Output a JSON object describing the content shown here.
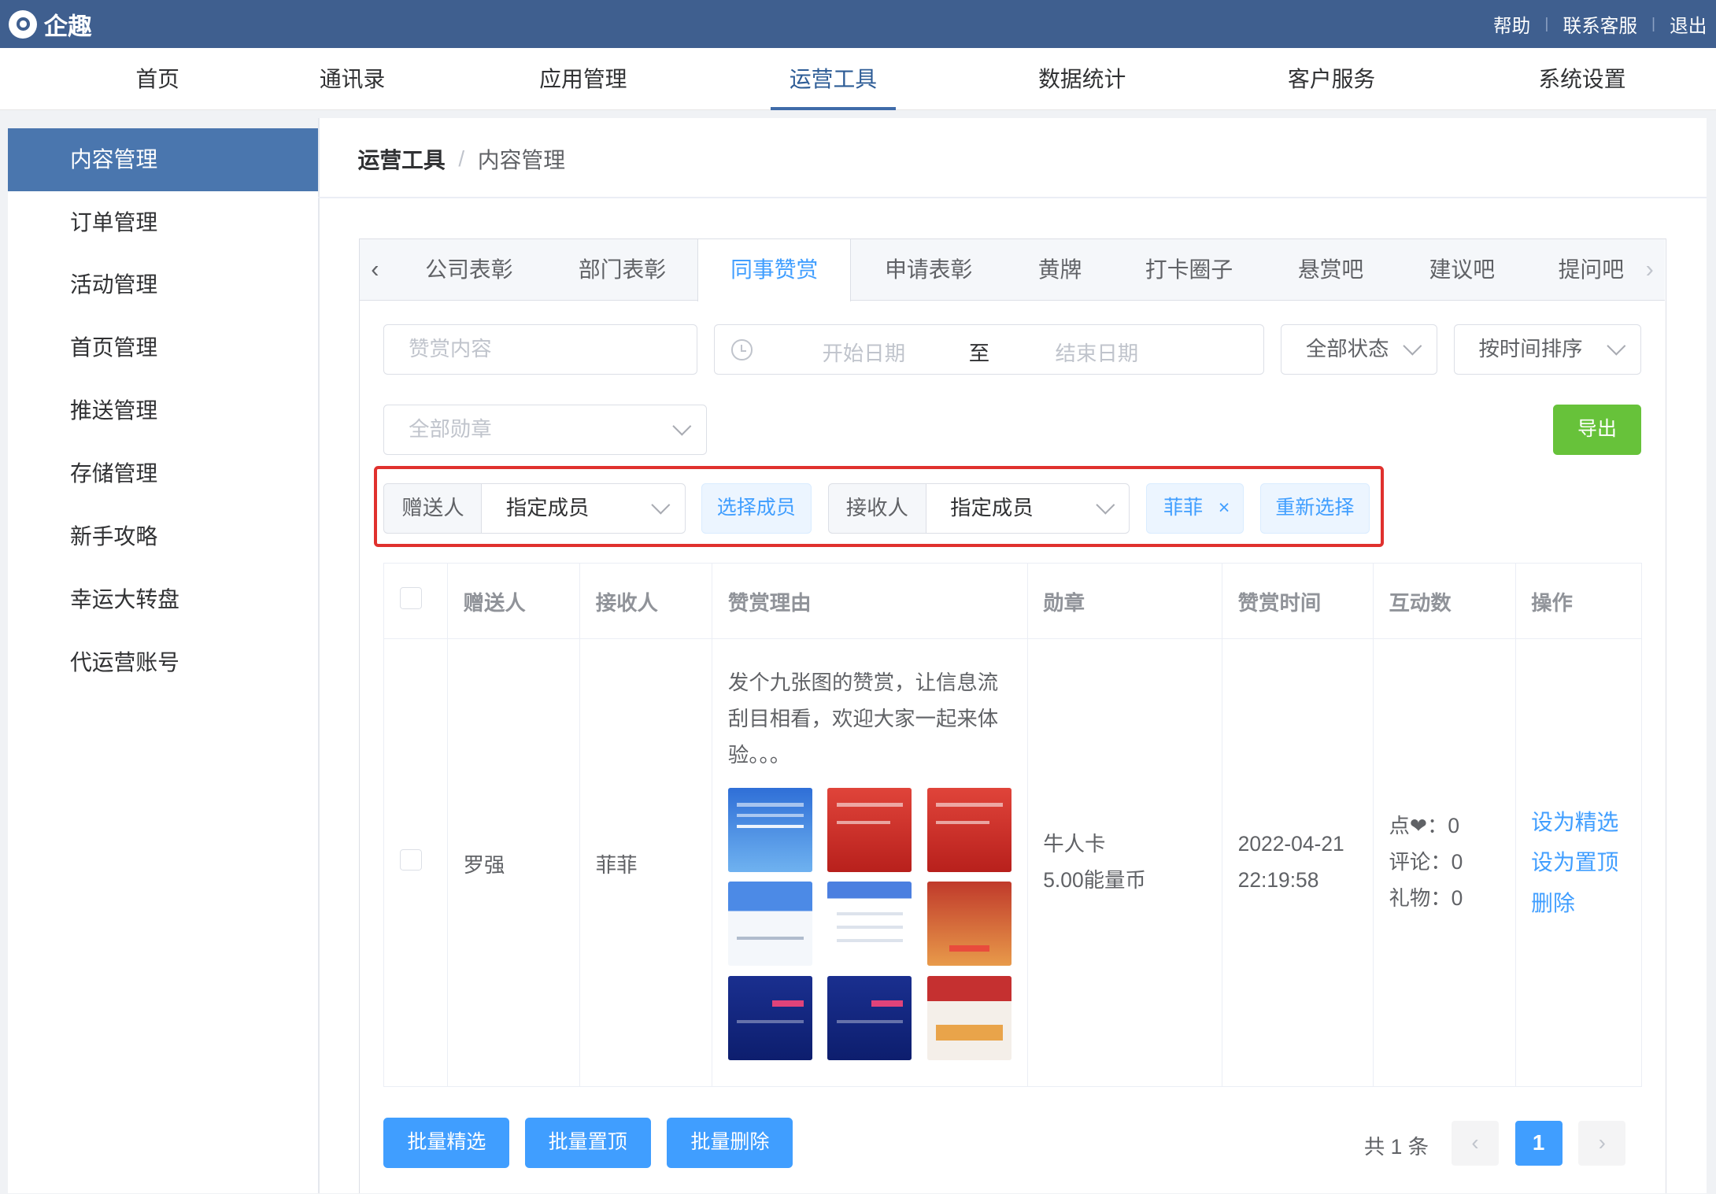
{
  "app": {
    "name": "企趣"
  },
  "toplinks": [
    "帮助",
    "联系客服",
    "退出"
  ],
  "nav": [
    "首页",
    "通讯录",
    "应用管理",
    "运营工具",
    "数据统计",
    "客户服务",
    "系统设置"
  ],
  "sidebar": [
    "内容管理",
    "订单管理",
    "活动管理",
    "首页管理",
    "推送管理",
    "存储管理",
    "新手攻略",
    "幸运大转盘",
    "代运营账号"
  ],
  "breadcrumb": {
    "parent": "运营工具",
    "sep": "/",
    "current": "内容管理"
  },
  "tabs": [
    "公司表彰",
    "部门表彰",
    "同事赞赏",
    "申请表彰",
    "黄牌",
    "打卡圈子",
    "悬赏吧",
    "建议吧",
    "提问吧"
  ],
  "filters": {
    "content_placeholder": "赞赏内容",
    "start_placeholder": "开始日期",
    "range_sep": "至",
    "end_placeholder": "结束日期",
    "status": "全部状态",
    "sort": "按时间排序",
    "medal_placeholder": "全部勋章",
    "export": "导出"
  },
  "member_filter": {
    "sender_label": "赠送人",
    "sender_select": "指定成员",
    "choose_btn": "选择成员",
    "receiver_label": "接收人",
    "receiver_select": "指定成员",
    "selected_tag": "菲菲",
    "reselect_btn": "重新选择"
  },
  "table": {
    "headers": [
      "赠送人",
      "接收人",
      "赞赏理由",
      "勋章",
      "赞赏时间",
      "互动数",
      "操作"
    ],
    "rows": [
      {
        "sender": "罗强",
        "receiver": "菲菲",
        "reason": "发个九张图的赞赏，让信息流刮目相看，欢迎大家一起来体验。。。",
        "medal_name": "牛人卡",
        "medal_value": "5.00能量币",
        "date": "2022-04-21",
        "time": "22:19:58",
        "likes": "点❤：0",
        "comments": "评论：0",
        "gifts": "礼物：0",
        "actions": [
          "设为精选",
          "设为置顶",
          "删除"
        ]
      }
    ]
  },
  "bulk": [
    "批量精选",
    "批量置顶",
    "批量删除"
  ],
  "pagination": {
    "total": "共 1 条",
    "current": "1"
  }
}
